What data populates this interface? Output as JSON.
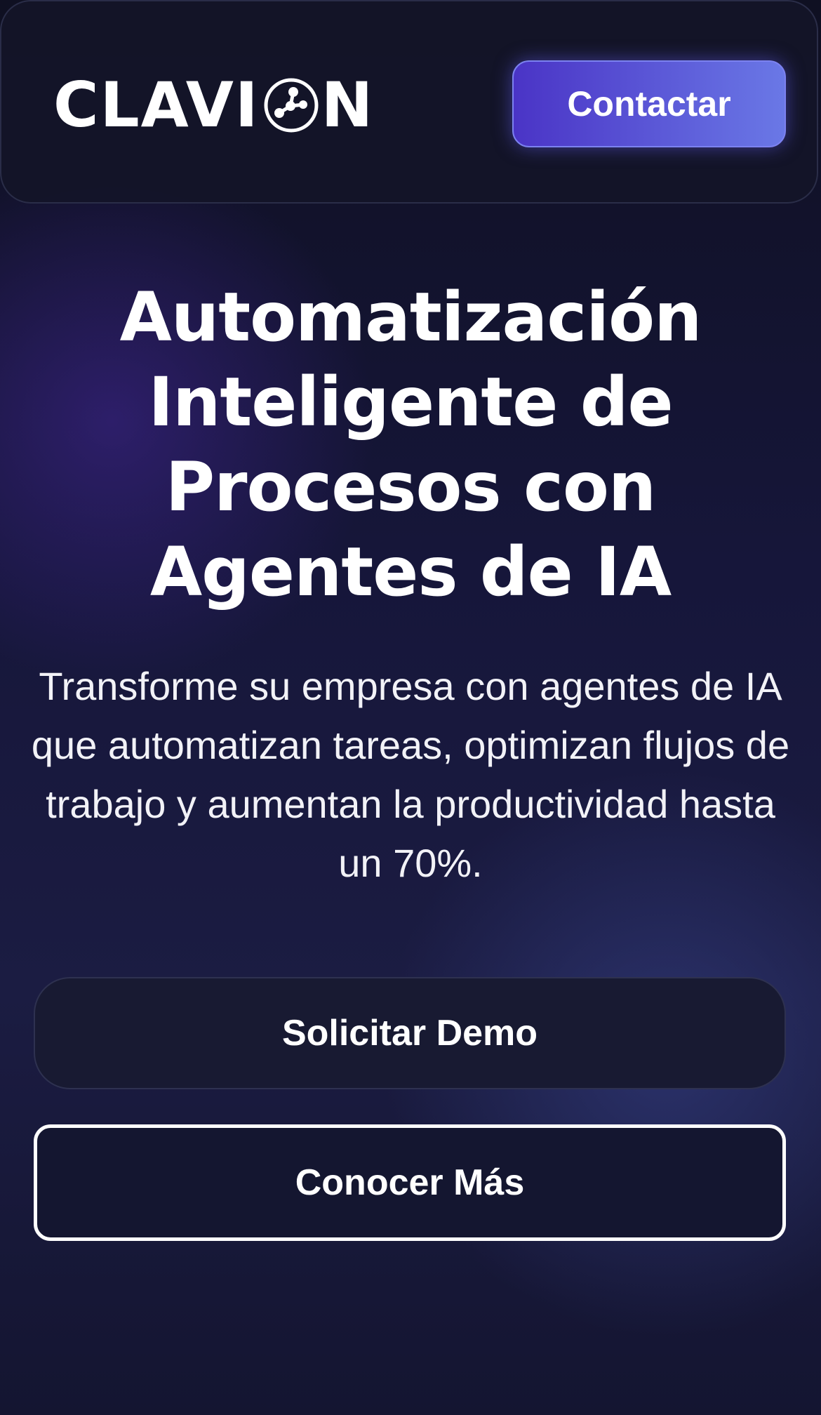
{
  "header": {
    "logo": {
      "before_icon": "CLAVI",
      "after_icon": "N",
      "icon": "network-nodes-icon"
    },
    "contact_label": "Contactar"
  },
  "hero": {
    "title": "Automatización Inteligente de Procesos con Agentes de IA",
    "subtitle": "Transforme su empresa con agentes de IA que automatizan tareas, optimizan flujos de trabajo y aumentan la productividad hasta un 70%."
  },
  "actions": {
    "demo_label": "Solicitar Demo",
    "more_label": "Conocer Más"
  },
  "colors": {
    "background": "#16163a",
    "accent_start": "#4a34c6",
    "accent_end": "#6a78e6",
    "text": "#ffffff"
  }
}
